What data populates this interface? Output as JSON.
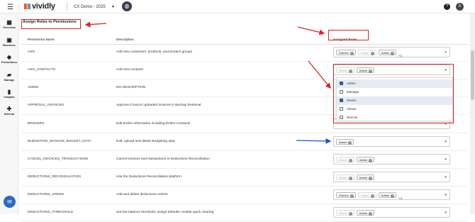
{
  "topbar": {
    "brand": "vividly",
    "environment": "CX Demo - 2025",
    "help_icon": "help-icon",
    "avatar_initial": "A"
  },
  "sidebar": {
    "items": [
      {
        "label": "Overview",
        "icon": "overview-icon"
      },
      {
        "label": "Business",
        "icon": "business-icon"
      },
      {
        "label": "Promotions",
        "icon": "promotions-icon"
      },
      {
        "label": "Manage",
        "icon": "manage-icon"
      },
      {
        "label": "Insights",
        "icon": "insights-icon"
      },
      {
        "label": "Internal",
        "icon": "internal-icon"
      }
    ]
  },
  "section": {
    "title": "Assign Roles to Permissions"
  },
  "table": {
    "headers": {
      "name": "Permission Name",
      "description": "Description",
      "roles": "Assigned Roles"
    },
    "rows": [
      {
        "name": "ASO",
        "description": "Add new customers, products, and product groups",
        "chips": [
          {
            "t": "Director",
            "dim": false
          },
          {
            "t": "Owner",
            "dim": true
          },
          {
            "t": "Admin",
            "dim": false
          }
        ],
        "more": "+1"
      },
      {
        "name": "ASO_CONTACTS",
        "description": "Add new contacts",
        "chips": [
          {
            "t": "Owner",
            "dim": true
          },
          {
            "t": "Admin",
            "dim": false
          }
        ],
        "more": ""
      },
      {
        "name": "ADMIN",
        "description": "NO DESCRIPTION",
        "chips": [],
        "more": ""
      },
      {
        "name": "APPROVAL_INVOICES",
        "description": "Approve iCrescor uploaded invoices in Backup Retrieval",
        "chips": [],
        "more": ""
      },
      {
        "name": "BROKERS",
        "description": "Edit broker information including broker contracts",
        "chips": [],
        "more": ""
      },
      {
        "name": "BUDGETING_MANAGE_BUDGET_DATA",
        "description": "Edit, upload and delete Budgeting data",
        "chips": [
          {
            "t": "Admin",
            "dim": false
          }
        ],
        "more": ""
      },
      {
        "name": "CANCEL_INVOICES_TRANSACTIONS",
        "description": "Cancel invoices and transactions in Deductions Reconciliation",
        "chips": [
          {
            "t": "Owner",
            "dim": true
          },
          {
            "t": "Admin",
            "dim": false
          }
        ],
        "more": ""
      },
      {
        "name": "DEDUCTIONS_RECONCILIATION",
        "description": "Use the Deductions Reconciliation platform",
        "chips": [
          {
            "t": "Owner",
            "dim": true
          },
          {
            "t": "Admin",
            "dim": false
          }
        ],
        "more": ""
      },
      {
        "name": "DEDUCTIONS_SPEND",
        "description": "Add and delete deductions entries",
        "chips": [
          {
            "t": "Director",
            "dim": false
          },
          {
            "t": "Owner",
            "dim": true
          },
          {
            "t": "Admin",
            "dim": false
          }
        ],
        "more": "+1"
      },
      {
        "name": "DEDUCTIONS_THRESHOLD",
        "description": "Set low balance threshold, assign defaults, enable quick clearing",
        "chips": [
          {
            "t": "Owner",
            "dim": true
          },
          {
            "t": "Admin",
            "dim": false
          }
        ],
        "more": ""
      }
    ]
  },
  "dropdown": {
    "options": [
      {
        "label": "Admin",
        "checked": true,
        "highlight": true
      },
      {
        "label": "Manager",
        "checked": false,
        "highlight": false
      },
      {
        "label": "Owner",
        "checked": true,
        "highlight": true
      },
      {
        "label": "Viewer",
        "checked": false,
        "highlight": false
      },
      {
        "label": "Director",
        "checked": false,
        "highlight": false
      }
    ]
  },
  "annotations": {
    "red": "#e02020",
    "blue": "#1f4fd6"
  }
}
